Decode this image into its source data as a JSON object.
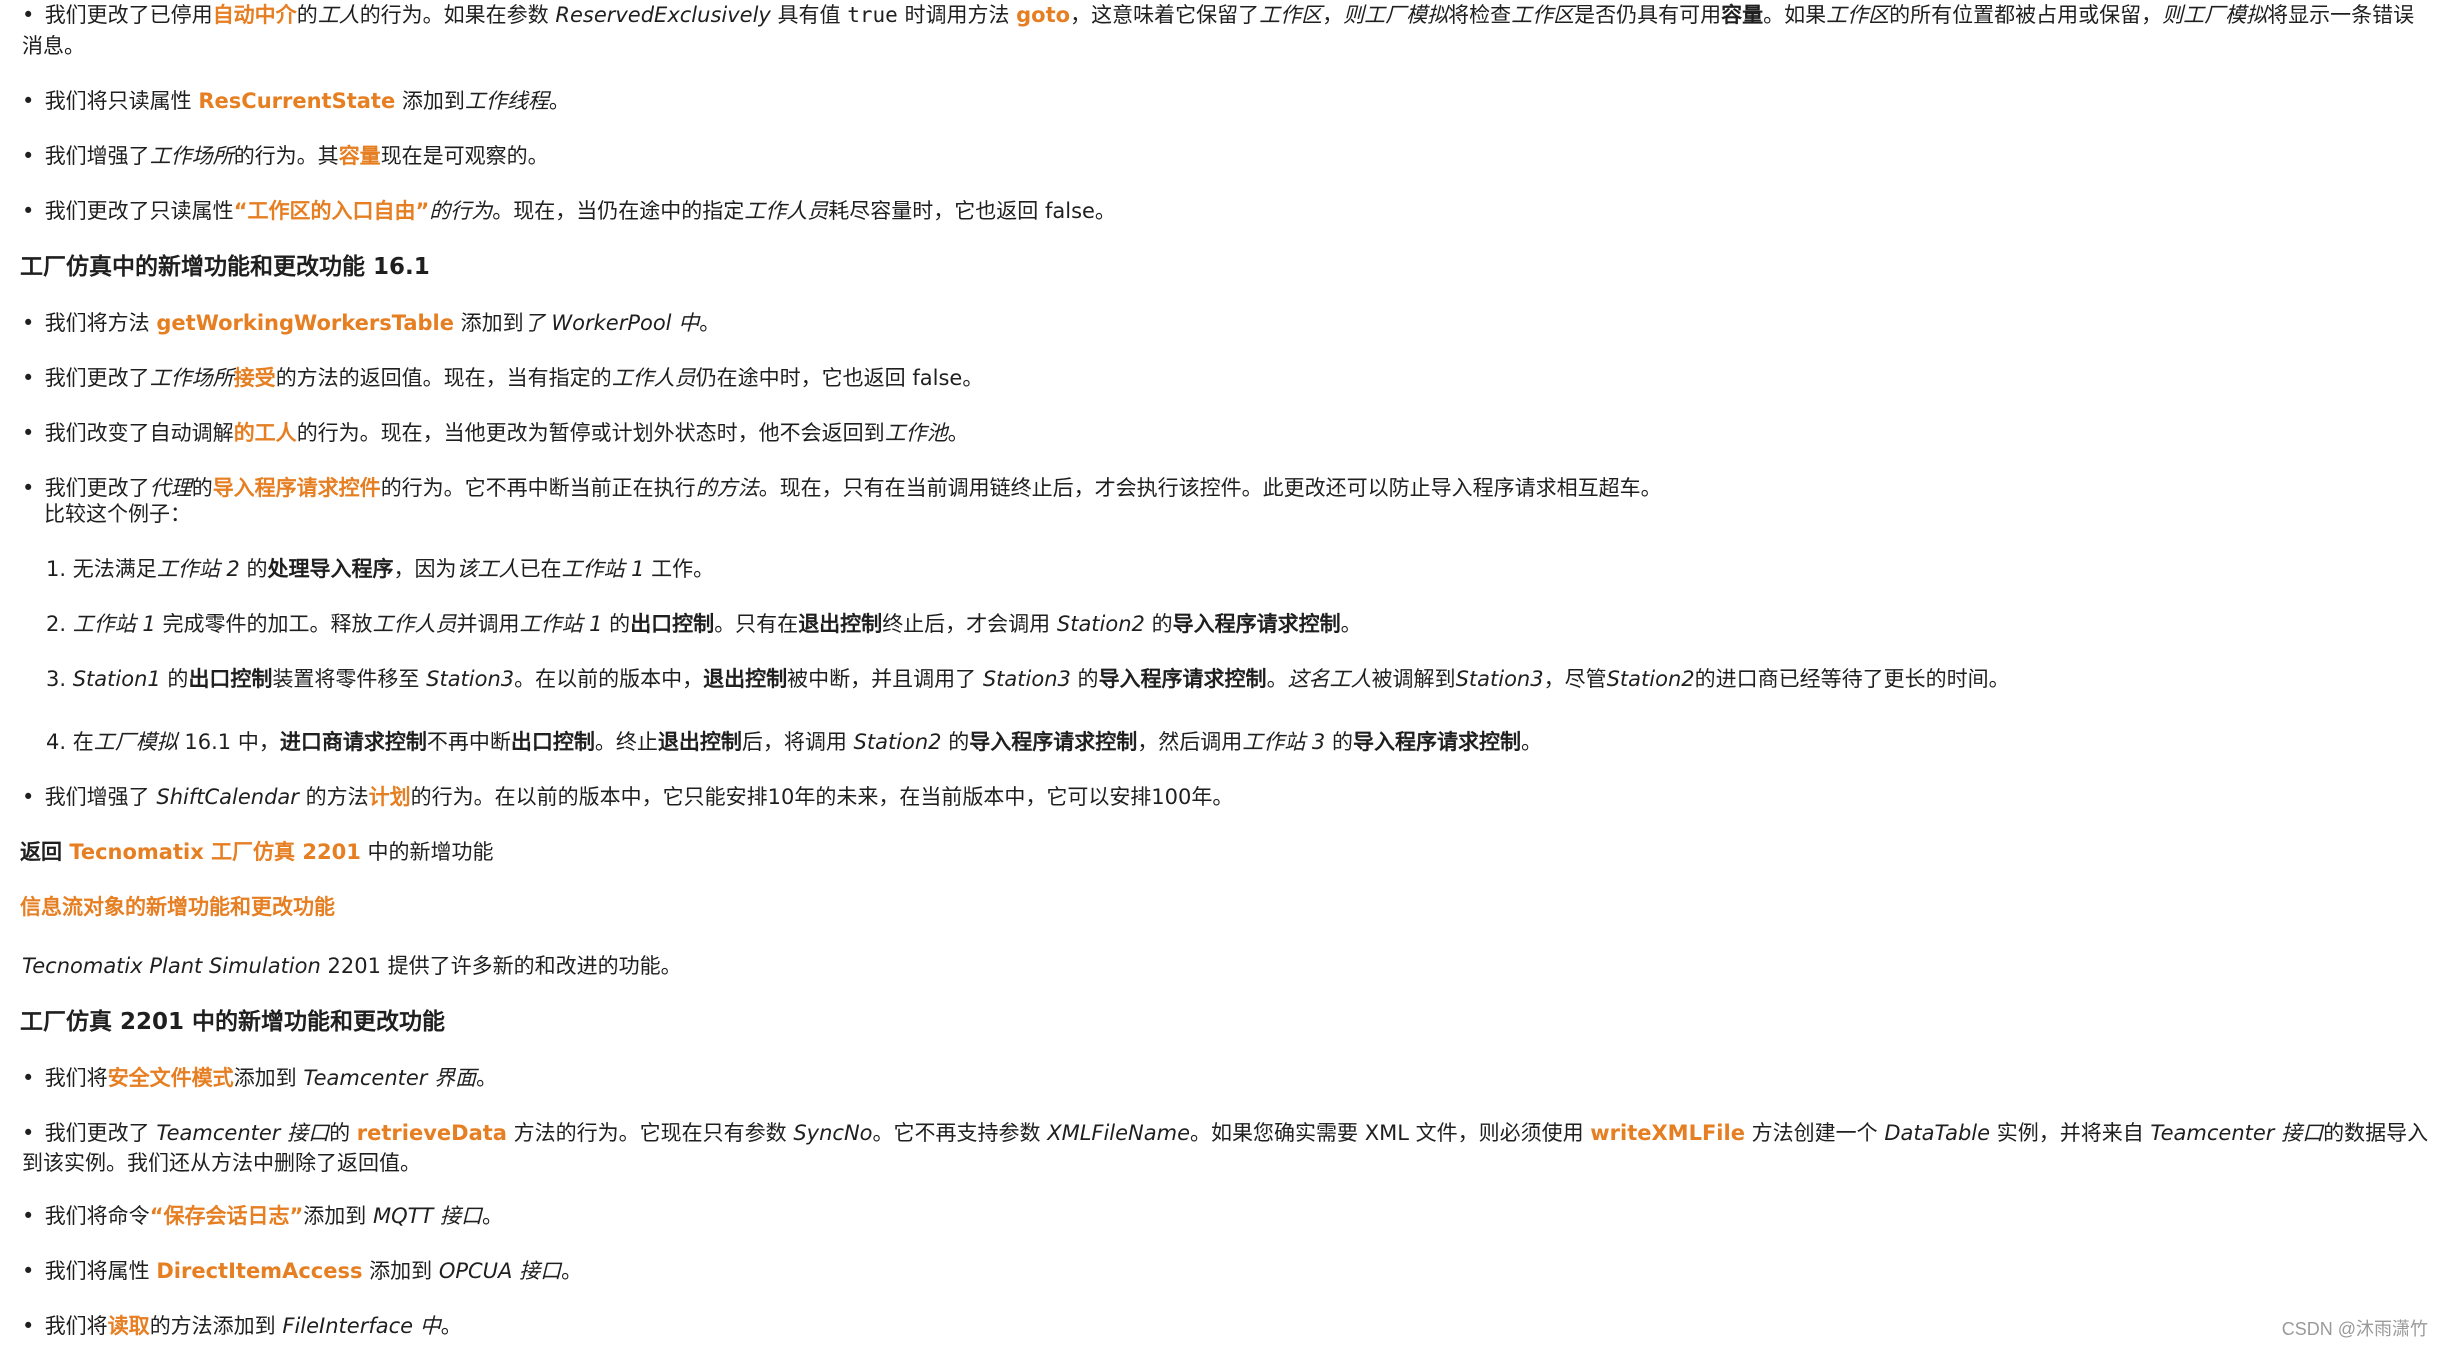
{
  "p0": {
    "t1": "我们更改了已停用",
    "l1": "自动中介",
    "t2": "的",
    "i1": "工人",
    "t3": "的行为。如果在参数 ",
    "i2": "ReservedExclusively",
    "t4": " 具有值 ",
    "m1": "true",
    "t5": " 时调用方法 ",
    "l2": "goto",
    "t6": "，这意味着它保留了",
    "i3": "工作区",
    "t7": "，",
    "i4": "则工厂模拟",
    "t8": "将检查",
    "i5": "工作区",
    "t9": "是否仍具有可用",
    "b1": "容量",
    "t10": "。如果",
    "i6": "工作区",
    "t11": "的所有位置都被占用或保留，",
    "i7": "则工厂模拟",
    "t12": "将显示一条错误消息。"
  },
  "p1": {
    "t1": "我们将只读属性 ",
    "l1": "ResCurrentState",
    "t2": " 添加到",
    "i1": "工作线程",
    "t3": "。"
  },
  "p2": {
    "t1": "我们增强了",
    "i1": "工作场所",
    "t2": "的行为。其",
    "l1": "容量",
    "t3": "现在是可观察的。"
  },
  "p3": {
    "t1": "我们更改了只读属性",
    "l1": "“工作区的入口自由”",
    "i1": "的行为",
    "t2": "。现在，当仍在途中的指定",
    "i2": "工作人员",
    "t3": "耗尽容量时，它也返回 false。"
  },
  "h1": "工厂仿真中的新增功能和更改功能 16.1",
  "p4": {
    "t1": "我们将方法 ",
    "l1": "getWorkingWorkersTable",
    "t2": " 添加到",
    "i1": "了 WorkerPool 中",
    "t3": "。"
  },
  "p5": {
    "t1": "我们更改了",
    "i1": "工作场所",
    "l1": "接受",
    "t2": "的方法的返回值。现在，当有指定的",
    "i2": "工作人员",
    "t3": "仍在途中时，它也返回 false。"
  },
  "p6": {
    "t1": "我们改变了自动调解",
    "l1": "的工人",
    "t2": "的行为。现在，当他更改为暂停或计划外状态时，他不会返回到",
    "i1": "工作池",
    "t3": "。"
  },
  "p7": {
    "t1": "我们更改了",
    "i1": "代理",
    "t2": "的",
    "l1": "导入程序请求控件",
    "t3": "的行为。它不再中断当前正在执行",
    "i2": "的方法",
    "t4": "。现在，只有在当前调用链终止后，才会执行该控件。此更改还可以防止导入程序请求相互超车。",
    "t5": "比较这个例子："
  },
  "n1": {
    "n": "1",
    "t1": "无法满足",
    "i1": "工作站 2",
    "t2": " 的",
    "b1": "处理导入程序",
    "t3": "，因为",
    "i2": "该工人",
    "t4": "已在",
    "i3": "工作站 1",
    "t5": " 工作。"
  },
  "n2": {
    "n": "2",
    "i1": "工作站 1",
    "t1": " 完成零件的加工。释放",
    "i2": "工作人员",
    "t2": "并调用",
    "i3": "工作站 1",
    "t3": " 的",
    "b1": "出口控制",
    "t4": "。只有在",
    "b2": "退出控制",
    "t5": "终止后，才会调用 ",
    "i4": "Station2",
    "t6": " 的",
    "b3": "导入程序请求控制",
    "t7": "。"
  },
  "n3": {
    "n": "3",
    "i1": "Station1",
    "t1": " 的",
    "b1": "出口控制",
    "t2": "装置将零件移至 ",
    "i2": "Station3",
    "t3": "。在以前的版本中，",
    "b2": "退出控制",
    "t4": "被中断，并且调用了 ",
    "i3": "Station3",
    "t5": " 的",
    "b3": "导入程序请求控制",
    "t6": "。",
    "i4": "这名工人",
    "t7": "被调解到",
    "i5": "Station3",
    "t8": "，尽管",
    "i6": "Station2",
    "t9": "的进口商已经等待了更长的时间。"
  },
  "n4": {
    "n": "4",
    "t1": "在",
    "i1": "工厂模拟",
    "t2": " 16.1 中，",
    "b1": "进口商请求控制",
    "t3": "不再中断",
    "b2": "出口控制",
    "t4": "。终止",
    "b3": "退出控制",
    "t5": "后，将调用 ",
    "i2": "Station2",
    "t6": " 的",
    "b4": "导入程序请求控制",
    "t7": "，然后调用",
    "i3": "工作站 3",
    "t8": " 的",
    "b5": "导入程序请求控制",
    "t9": "。"
  },
  "p8": {
    "t1": "我们增强了 ",
    "i1": "ShiftCalendar",
    "t2": " 的方法",
    "l1": "计划",
    "t3": "的行为。在以前的版本中，它只能安排10年的未来，在当前版本中，它可以安排100年。"
  },
  "back": {
    "b1": "返回 ",
    "l1": "Tecnomatix 工厂仿真 2201",
    "t1": " 中的新增功能"
  },
  "infoflow": "信息流对象的新增功能和更改功能",
  "intro": {
    "i1": "Tecnomatix Plant Simulation",
    "t1": " 2201 提供了许多新的和改进的功能。"
  },
  "h2": "工厂仿真 2201 中的新增功能和更改功能",
  "p9": {
    "t1": "我们将",
    "l1": "安全文件模式",
    "t2": "添加到 ",
    "i1": "Teamcenter 界面",
    "t3": "。"
  },
  "p10": {
    "t1": "我们更改了 ",
    "i1": "Teamcenter 接口",
    "t2": "的 ",
    "l1": "retrieveData",
    "t3": " 方法的行为。它现在只有参数 ",
    "i2": "SyncNo",
    "t4": "。它不再支持参数 ",
    "i3": "XMLFileName",
    "t5": "。如果您确实需要 XML 文件，则必须使用 ",
    "l2": "writeXMLFile",
    "t6": " 方法创建一个 ",
    "i4": "DataTable",
    "t7": " 实例，并将来自 ",
    "i5": "Teamcenter 接口",
    "t8": "的数据导入到该实例。我们还从方法中删除了返回值。"
  },
  "p11": {
    "t1": "我们将命令",
    "l1": "“保存会话日志”",
    "t2": "添加到 ",
    "i1": "MQTT 接口",
    "t3": "。"
  },
  "p12": {
    "t1": "我们将属性 ",
    "l1": "DirectItemAccess",
    "t2": " 添加到 ",
    "i1": "OPCUA 接口",
    "t3": "。"
  },
  "p13": {
    "t1": "我们将",
    "l1": "读取",
    "t2": "的方法添加到 ",
    "i1": "FileInterface 中",
    "t3": "。"
  },
  "watermark": "CSDN @沐雨潇竹",
  "colors": {
    "link": "#e67e22",
    "text": "#1f1f1f",
    "watermark": "#9a9a9a"
  }
}
